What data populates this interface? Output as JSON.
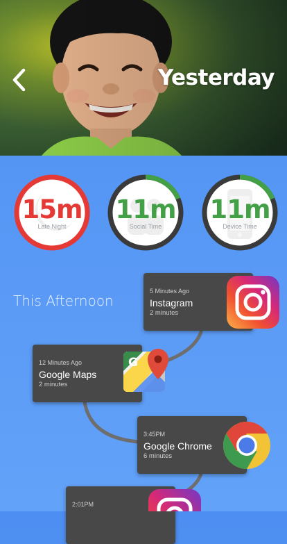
{
  "header": {
    "title": "Yesterday",
    "back_icon": "chevron-left-icon"
  },
  "stats": [
    {
      "value": "15m",
      "label": "Late Night",
      "color": "#e53935",
      "progress": 1.0,
      "icon": "moon-icon"
    },
    {
      "value": "11m",
      "label": "Social Time",
      "color": "#43a047",
      "progress": 0.12,
      "icon": "people-icon"
    },
    {
      "value": "11m",
      "label": "Device Time",
      "color": "#43a047",
      "progress": 0.12,
      "icon": "phone-icon"
    }
  ],
  "section_title": "This Afternoon",
  "timeline": [
    {
      "time": "5 Minutes Ago",
      "app": "Instagram",
      "duration": "2 minutes",
      "icon": "instagram-icon"
    },
    {
      "time": "12 Minutes Ago",
      "app": "Google Maps",
      "duration": "2 minutes",
      "icon": "google-maps-icon"
    },
    {
      "time": "3:45PM",
      "app": "Google Chrome",
      "duration": "6 minutes",
      "icon": "chrome-icon"
    },
    {
      "time": "2:01PM",
      "app": "",
      "duration": "",
      "icon": "instagram-icon"
    }
  ],
  "colors": {
    "background": "#5a9af6",
    "card": "#484848",
    "alert": "#e53935",
    "ok": "#43a047"
  }
}
